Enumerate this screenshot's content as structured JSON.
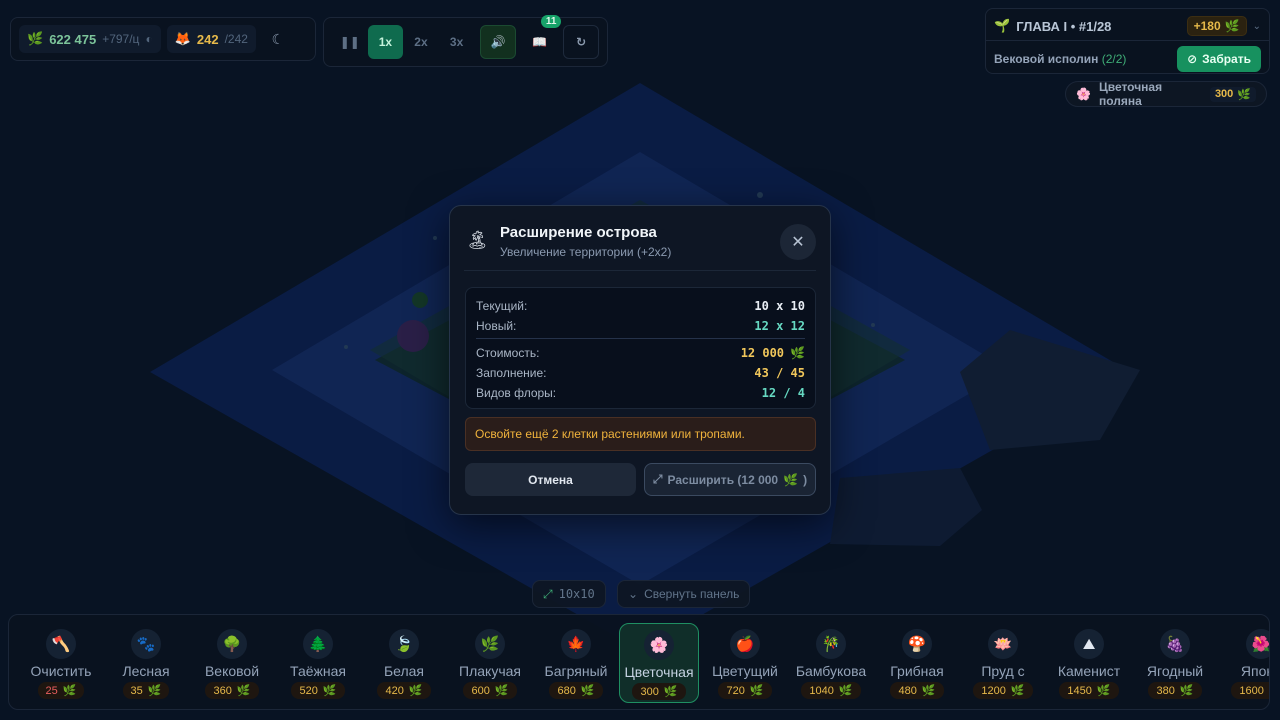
{
  "hud": {
    "leaves": "622 475",
    "leaves_rate": "+797/ц",
    "creatures": "242",
    "creatures_max": "/242"
  },
  "controls": {
    "speeds": [
      "1x",
      "2x",
      "3x"
    ],
    "active_speed": "1x",
    "book_badge": "11"
  },
  "quest": {
    "chapter": "ГЛАВА I • #1/28",
    "reward": "+180",
    "name": "Вековой исполин",
    "progress": "(2/2)",
    "claim_label": "Забрать"
  },
  "hint": {
    "name": "Цветочная поляна",
    "cost": "300"
  },
  "map_size": "10x10",
  "collapse_label": "Свернуть панель",
  "modal": {
    "title": "Расширение острова",
    "subtitle": "Увеличение территории (+2x2)",
    "current_label": "Текущий:",
    "current_value": "10 x 10",
    "new_label": "Новый:",
    "new_value": "12 x 12",
    "cost_label": "Стоимость:",
    "cost_value": "12 000",
    "fill_label": "Заполнение:",
    "fill_value": "43 / 45",
    "flora_label": "Видов флоры:",
    "flora_value": "12 / 4",
    "warning": "Освойте ещё 2 клетки растениями или тропами.",
    "cancel_label": "Отмена",
    "expand_label": "Расширить (12 000",
    "expand_close": ")"
  },
  "toolbar": {
    "tools": [
      {
        "name": "Очистить",
        "price": "25",
        "icon": "axe-icon",
        "glyph": "🪓"
      },
      {
        "name": "Лесная",
        "price": "35",
        "icon": "paw-icon",
        "glyph": "🐾"
      },
      {
        "name": "Вековой",
        "price": "360",
        "icon": "tree-icon",
        "glyph": "🌳"
      },
      {
        "name": "Таёжная",
        "price": "520",
        "icon": "pine-icon",
        "glyph": "🌲"
      },
      {
        "name": "Белая",
        "price": "420",
        "icon": "leaf-icon",
        "glyph": "🍃"
      },
      {
        "name": "Плакучая",
        "price": "600",
        "icon": "willow-icon",
        "glyph": "🌿"
      },
      {
        "name": "Багряный",
        "price": "680",
        "icon": "maple-icon",
        "glyph": "🍁"
      },
      {
        "name": "Цветочная",
        "price": "300",
        "icon": "flower-icon",
        "glyph": "🌸"
      },
      {
        "name": "Цветущий",
        "price": "720",
        "icon": "apple-icon",
        "glyph": "🍎"
      },
      {
        "name": "Бамбукова",
        "price": "1040",
        "icon": "bamboo-icon",
        "glyph": "🎋"
      },
      {
        "name": "Грибная",
        "price": "480",
        "icon": "mushroom-icon",
        "glyph": "🍄"
      },
      {
        "name": "Пруд с",
        "price": "1200",
        "icon": "pond-icon",
        "glyph": "🪷"
      },
      {
        "name": "Каменист",
        "price": "1450",
        "icon": "rock-icon",
        "glyph": "⛰"
      },
      {
        "name": "Ягодный",
        "price": "380",
        "icon": "berry-icon",
        "glyph": "🍇"
      },
      {
        "name": "Японс",
        "price": "1600",
        "icon": "sakura-icon",
        "glyph": "🌺"
      }
    ],
    "selected": "Цветочная"
  },
  "colors": {
    "accent": "#17915f",
    "gold": "#e6b94a",
    "teal": "#66d9c2",
    "warning": "#f0b33c"
  }
}
